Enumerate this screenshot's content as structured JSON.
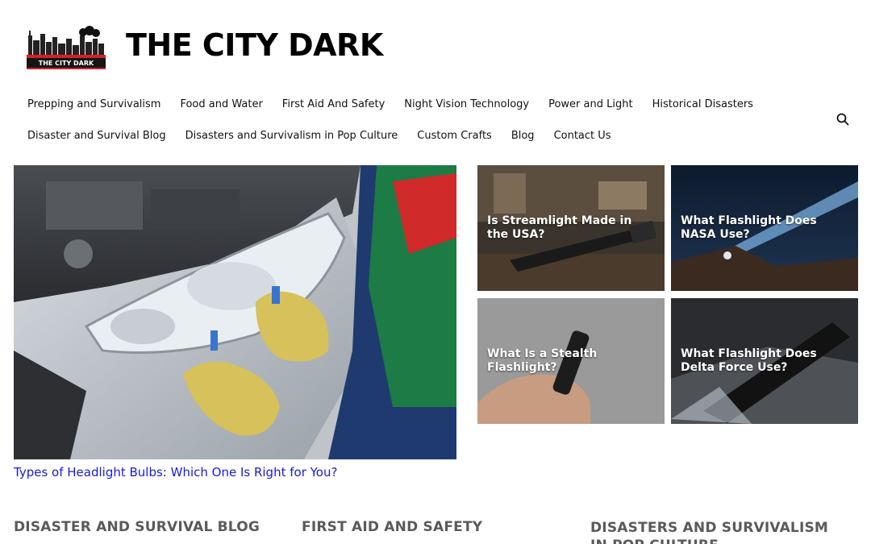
{
  "site": {
    "title": "THE CITY DARK",
    "logo_text": "THE CITY DARK"
  },
  "nav": {
    "row1": [
      "Prepping and Survivalism",
      "Food and Water",
      "First Aid And Safety",
      "Night Vision Technology",
      "Power and Light",
      "Historical Disasters"
    ],
    "row2": [
      "Disaster and Survival Blog",
      "Disasters and Survivalism in Pop Culture",
      "Custom Crafts",
      "Blog",
      "Contact Us"
    ],
    "search_icon": "search-icon"
  },
  "hero": {
    "link_text": "Types of Headlight Bulbs: Which One Is Right for You?"
  },
  "cards": [
    {
      "title": "Is Streamlight Made in the USA?"
    },
    {
      "title": "What Flashlight Does NASA Use?"
    },
    {
      "title": "What Is a Stealth Flashlight?"
    },
    {
      "title": "What Flashlight Does Delta Force Use?"
    }
  ],
  "footer": {
    "columns": [
      "DISASTER AND SURVIVAL BLOG",
      "FIRST AID AND SAFETY",
      "DISASTERS AND SURVIVALISM IN POP CULTURE"
    ]
  },
  "colors": {
    "link": "#1a1adb",
    "logo_red": "#d4202a",
    "column_heading": "#5a5a5a"
  }
}
